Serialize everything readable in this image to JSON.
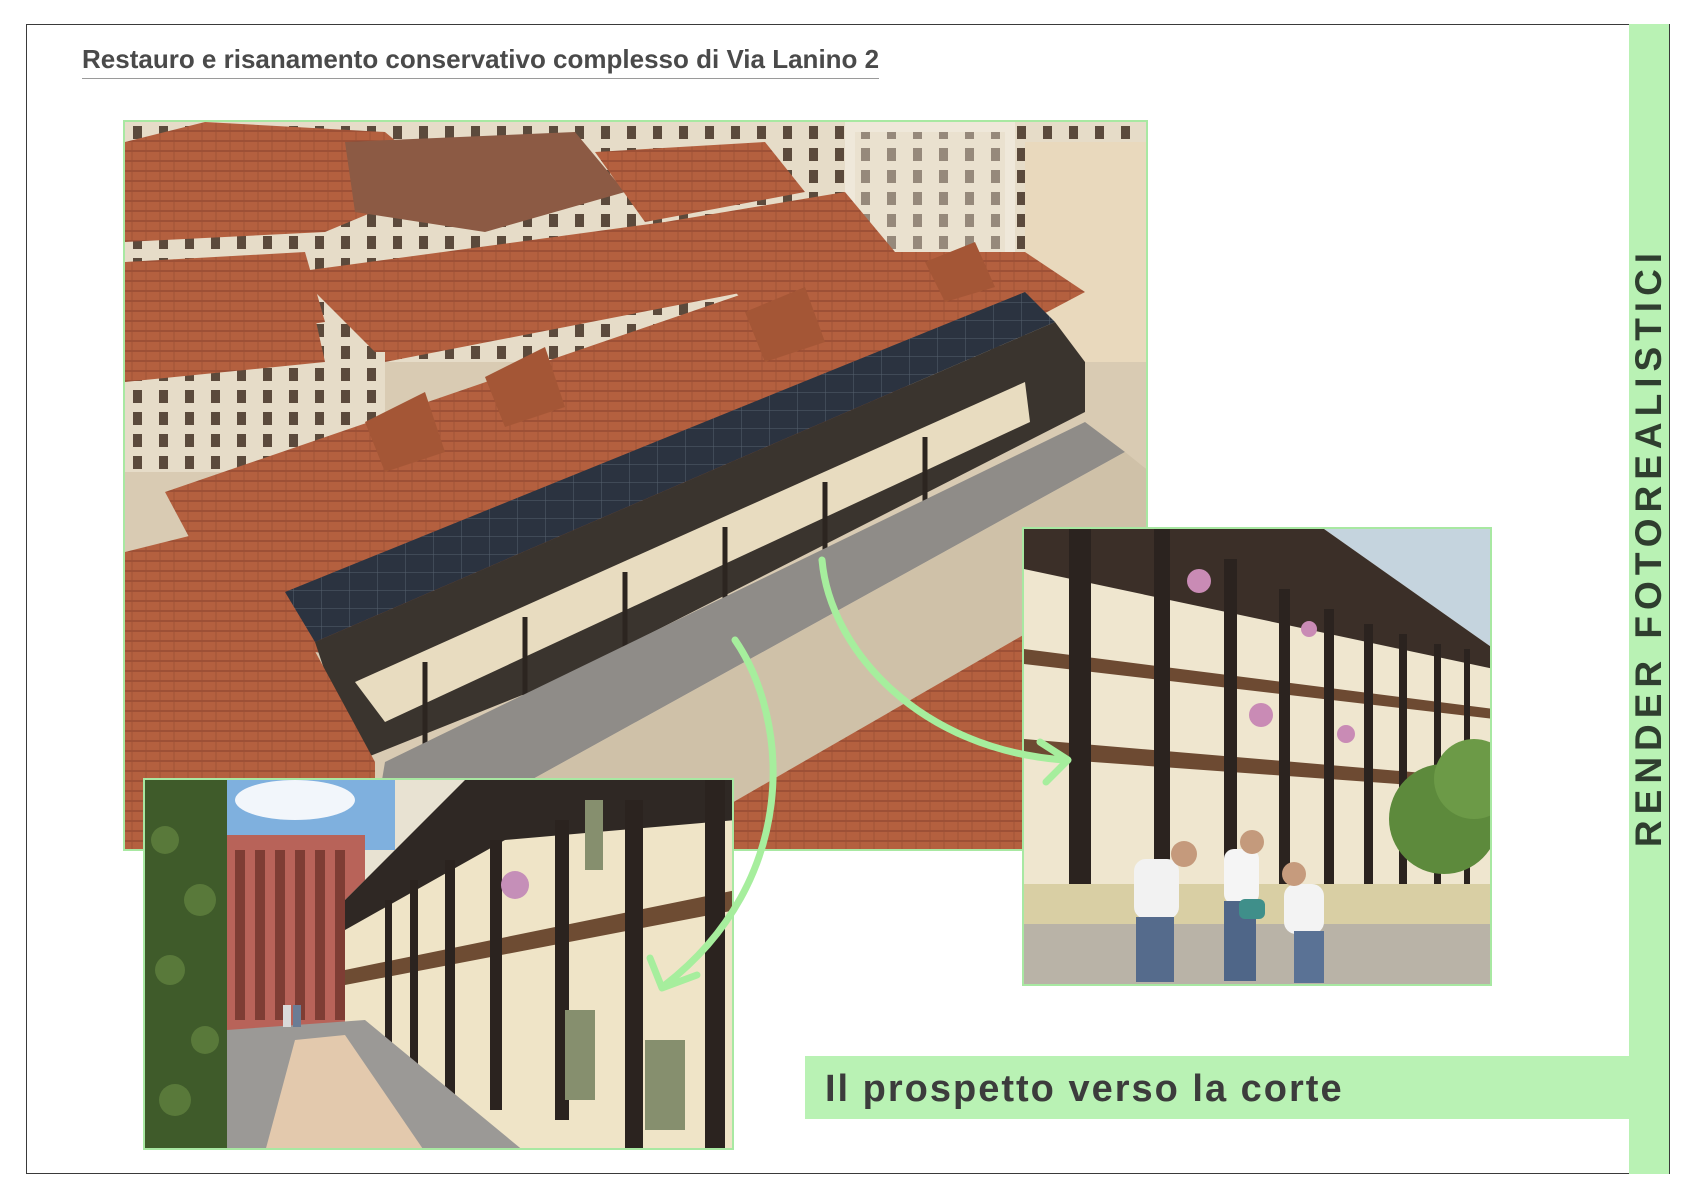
{
  "header": {
    "title": "Restauro e risanamento conservativo complesso di Via Lanino 2"
  },
  "sidebar": {
    "label": "RENDER FOTOREALISTICI"
  },
  "caption": {
    "text": "Il prospetto verso la corte"
  },
  "colors": {
    "accent_green": "#b9f2b4",
    "arrow_green": "#a6ee9d",
    "roof_terracotta": "#b0583c",
    "frame": "#3a3a3a"
  },
  "images": [
    {
      "name": "aerial-render",
      "icon": "rooftop-building-photo"
    },
    {
      "name": "courtyard-render-right",
      "icon": "loggia-gardening-photo"
    },
    {
      "name": "courtyard-render-left",
      "icon": "loggia-courtyard-photo"
    }
  ]
}
